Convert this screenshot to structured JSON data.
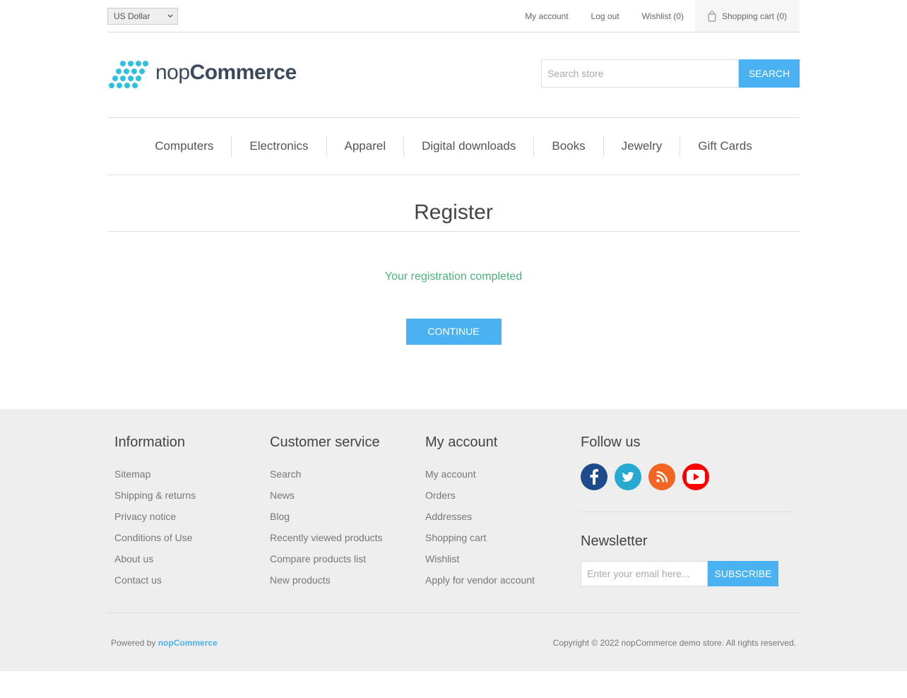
{
  "header": {
    "currency": "US Dollar",
    "links": [
      "My account",
      "Log out",
      "Wishlist (0)"
    ],
    "cart_label": "Shopping cart (0)"
  },
  "logo": {
    "light": "nop",
    "bold": "Commerce"
  },
  "search": {
    "placeholder": "Search store",
    "button": "SEARCH"
  },
  "menu": [
    "Computers",
    "Electronics",
    "Apparel",
    "Digital downloads",
    "Books",
    "Jewelry",
    "Gift Cards"
  ],
  "page": {
    "title": "Register",
    "result": "Your registration completed",
    "continue": "CONTINUE"
  },
  "footer": {
    "information": {
      "title": "Information",
      "items": [
        "Sitemap",
        "Shipping & returns",
        "Privacy notice",
        "Conditions of Use",
        "About us",
        "Contact us"
      ]
    },
    "customer_service": {
      "title": "Customer service",
      "items": [
        "Search",
        "News",
        "Blog",
        "Recently viewed products",
        "Compare products list",
        "New products"
      ]
    },
    "my_account": {
      "title": "My account",
      "items": [
        "My account",
        "Orders",
        "Addresses",
        "Shopping cart",
        "Wishlist",
        "Apply for vendor account"
      ]
    },
    "follow_us": {
      "title": "Follow us"
    },
    "newsletter": {
      "title": "Newsletter",
      "placeholder": "Enter your email here...",
      "button": "SUBSCRIBE"
    },
    "powered_prefix": "Powered by",
    "powered_link": "nopCommerce",
    "copyright": "Copyright © 2022 nopCommerce demo store. All rights reserved."
  },
  "colors": {
    "accent": "#4ab2f1",
    "success": "#4cb17c",
    "footer_bg": "#eeeeee"
  }
}
